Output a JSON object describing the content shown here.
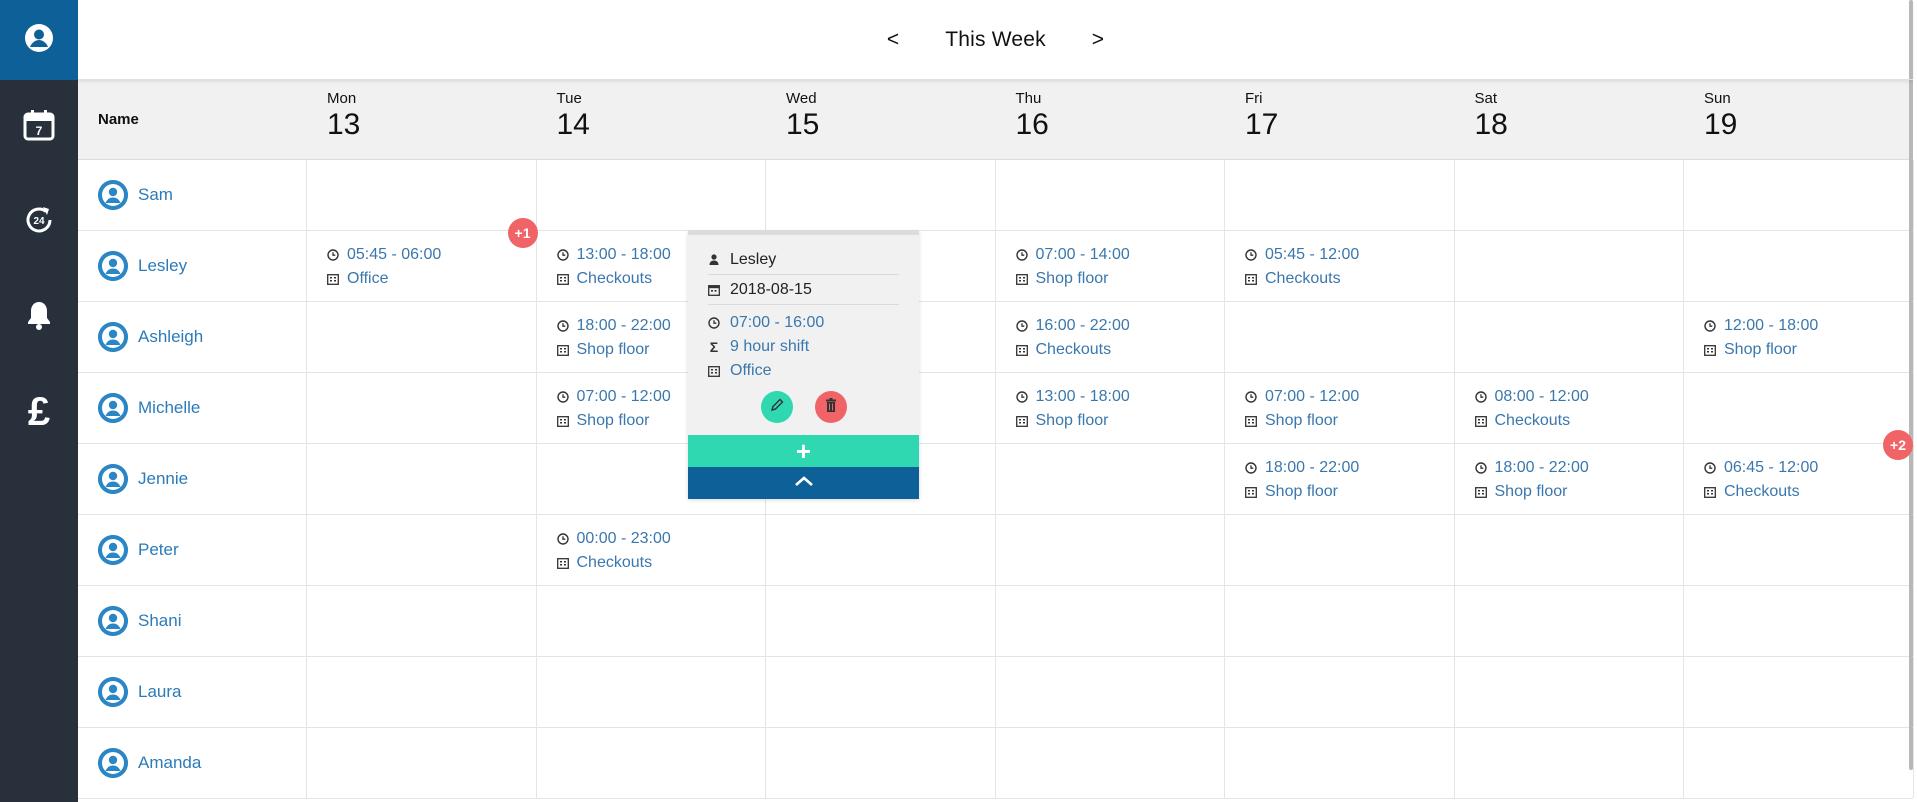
{
  "week_nav": {
    "prev": "<",
    "title": "This Week",
    "next": ">"
  },
  "sidebar": {
    "items": [
      {
        "icon": "user-icon"
      },
      {
        "icon": "calendar-icon",
        "glyph": "7"
      },
      {
        "icon": "refresh-24-icon",
        "glyph": "24"
      },
      {
        "icon": "bell-icon"
      },
      {
        "icon": "pound-icon",
        "glyph": "£"
      }
    ]
  },
  "header": {
    "name_label": "Name",
    "days": [
      {
        "name": "Mon",
        "num": "13"
      },
      {
        "name": "Tue",
        "num": "14"
      },
      {
        "name": "Wed",
        "num": "15"
      },
      {
        "name": "Thu",
        "num": "16"
      },
      {
        "name": "Fri",
        "num": "17"
      },
      {
        "name": "Sat",
        "num": "18"
      },
      {
        "name": "Sun",
        "num": "19"
      }
    ]
  },
  "staff": [
    {
      "name": "Sam"
    },
    {
      "name": "Lesley"
    },
    {
      "name": "Ashleigh"
    },
    {
      "name": "Michelle"
    },
    {
      "name": "Jennie"
    },
    {
      "name": "Peter"
    },
    {
      "name": "Shani"
    },
    {
      "name": "Laura"
    },
    {
      "name": "Amanda"
    }
  ],
  "shifts": [
    {
      "id": "s0",
      "time": "05:45 - 06:00",
      "area": "Office"
    },
    {
      "id": "s1",
      "time": "13:00 - 18:00",
      "area": "Checkouts"
    },
    {
      "id": "s2",
      "time": "07:00 - 14:00",
      "area": "Shop floor"
    },
    {
      "id": "s3",
      "time": "05:45 - 12:00",
      "area": "Checkouts"
    },
    {
      "id": "s4",
      "time": "18:00 - 22:00",
      "area": "Shop floor"
    },
    {
      "id": "s5",
      "time": "16:00 - 22:00",
      "area": "Checkouts"
    },
    {
      "id": "s6",
      "time": "12:00 - 18:00",
      "area": "Shop floor"
    },
    {
      "id": "s7",
      "time": "07:00 - 12:00",
      "area": "Shop floor"
    },
    {
      "id": "s8",
      "time": "13:00 - 18:00",
      "area": "Shop floor"
    },
    {
      "id": "s9",
      "time": "07:00 - 12:00",
      "area": "Shop floor"
    },
    {
      "id": "s10",
      "time": "08:00 - 12:00",
      "area": "Checkouts"
    },
    {
      "id": "s11",
      "time": "18:00 - 22:00",
      "area": "Shop floor"
    },
    {
      "id": "s12",
      "time": "18:00 - 22:00",
      "area": "Shop floor"
    },
    {
      "id": "s13",
      "time": "06:45 - 12:00",
      "area": "Checkouts"
    },
    {
      "id": "s14",
      "time": "00:00 - 23:00",
      "area": "Checkouts"
    }
  ],
  "badges": {
    "lesley_mon": "+1",
    "jennie_sun": "+2"
  },
  "popup": {
    "person": "Lesley",
    "date": "2018-08-15",
    "time": "07:00 - 16:00",
    "duration": "9 hour shift",
    "area": "Office",
    "add_label": "+"
  },
  "colors": {
    "sidebar": "#27303b",
    "sidebar_active": "#0e6198",
    "link": "#3a77ad",
    "add": "#2fd8b1",
    "delete": "#f06468",
    "badge": "#f06468"
  }
}
